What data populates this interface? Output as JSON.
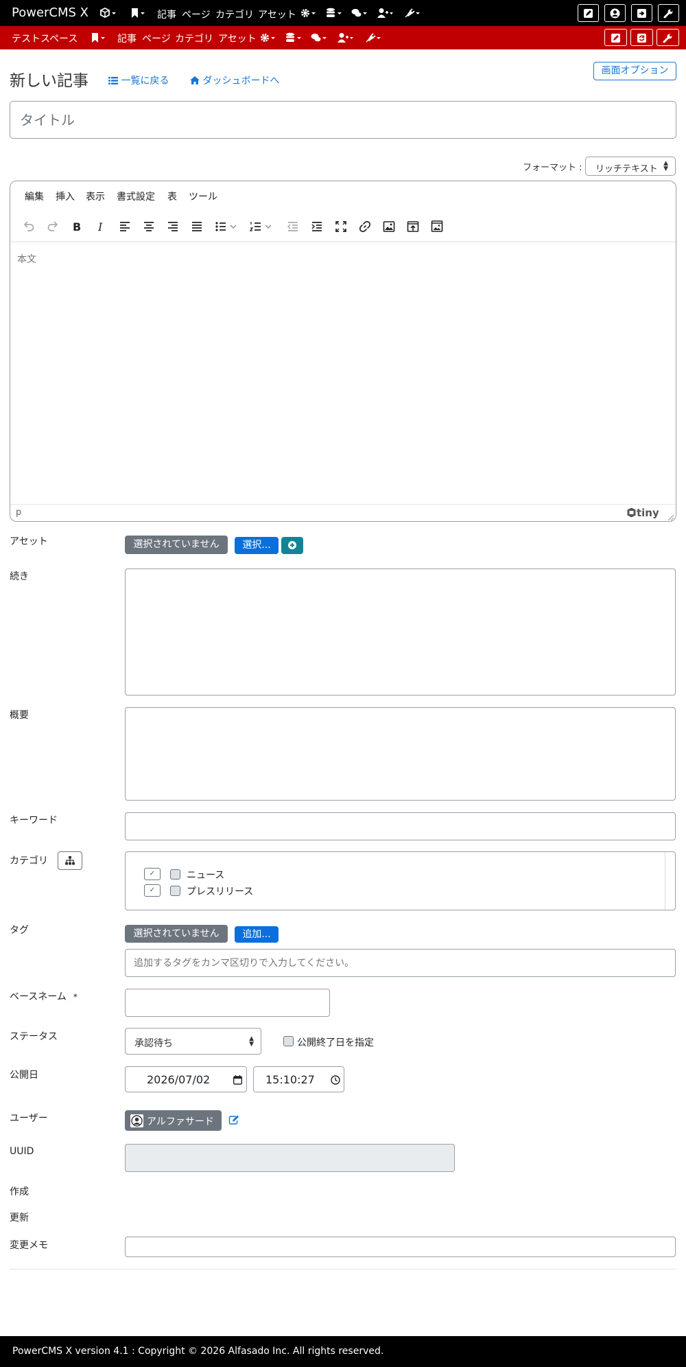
{
  "topbar": {
    "brand": "PowerCMS X",
    "nav": {
      "entries": "記事",
      "pages": "ページ",
      "categories": "カテゴリ",
      "assets": "アセット"
    }
  },
  "spacebar": {
    "space_name": "テストスペース",
    "nav": {
      "entries": "記事",
      "pages": "ページ",
      "categories": "カテゴリ",
      "assets": "アセット"
    }
  },
  "header": {
    "title": "新しい記事",
    "back_link": "一覧に戻る",
    "dashboard_link": "ダッシュボードへ",
    "screen_options": "画面オプション"
  },
  "title_field": {
    "placeholder": "タイトル"
  },
  "format": {
    "label": "フォーマット :",
    "value": "リッチテキスト"
  },
  "editor": {
    "menus": [
      "編集",
      "挿入",
      "表示",
      "書式設定",
      "表",
      "ツール"
    ],
    "placeholder": "本文",
    "path": "p",
    "brand": "tiny"
  },
  "fields": {
    "asset": {
      "label": "アセット",
      "none": "選択されていません",
      "select": "選択..."
    },
    "more": {
      "label": "続き"
    },
    "excerpt": {
      "label": "概要"
    },
    "keywords": {
      "label": "キーワード"
    },
    "category": {
      "label": "カテゴリ",
      "items": [
        "ニュース",
        "プレスリリース"
      ]
    },
    "tags": {
      "label": "タグ",
      "none": "選択されていません",
      "add": "追加...",
      "placeholder": "追加するタグをカンマ区切りで入力してください。"
    },
    "basename": {
      "label": "ベースネーム",
      "required_mark": "*"
    },
    "status": {
      "label": "ステータス",
      "value": "承認待ち",
      "unpublish_label": "公開終了日を指定"
    },
    "published": {
      "label": "公開日",
      "date": "2026/07/02",
      "time": "15:10:27"
    },
    "user": {
      "label": "ユーザー",
      "name": "アルファサード"
    },
    "uuid": {
      "label": "UUID"
    },
    "created": {
      "label": "作成"
    },
    "modified": {
      "label": "更新"
    },
    "rev_note": {
      "label": "変更メモ"
    }
  },
  "footer": {
    "text": "PowerCMS X version 4.1 : Copyright © 2026 Alfasado Inc. All rights reserved."
  },
  "colors": {
    "topbar": "#000000",
    "spacebar": "#c00000",
    "link": "#1976d2",
    "primary_button": "#0a6fdc",
    "secondary_button": "#6c757d",
    "teal_button": "#138496"
  }
}
